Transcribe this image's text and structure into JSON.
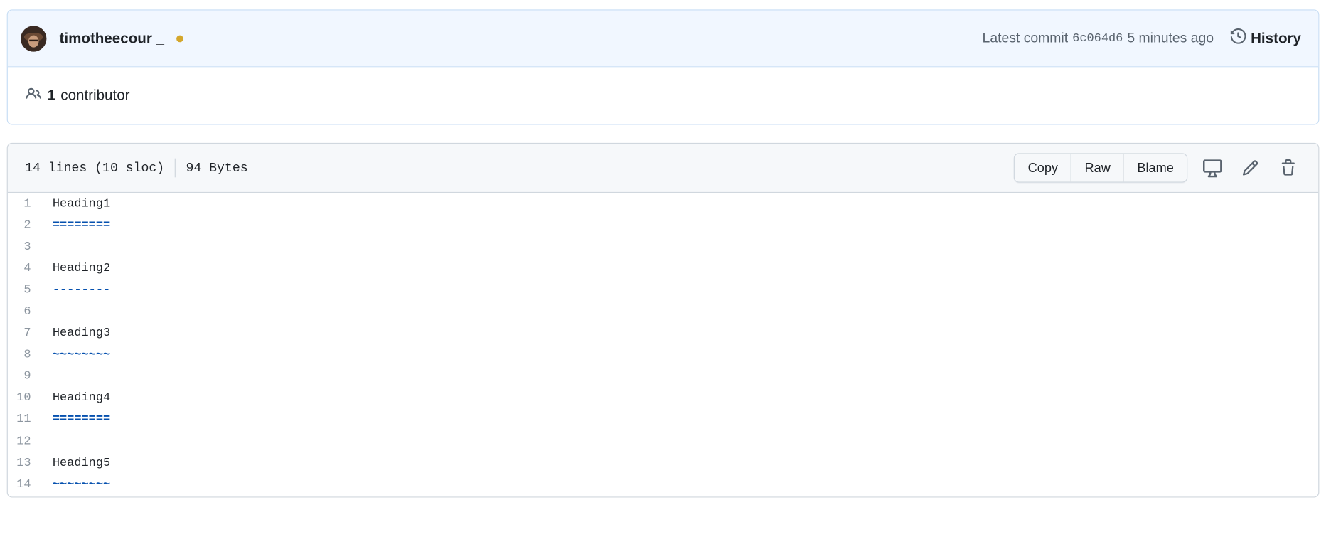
{
  "commit": {
    "author": "timotheecour _",
    "latest_commit_label": "Latest commit",
    "sha": "6c064d6",
    "time": "5 minutes ago",
    "history_label": "History",
    "status_color": "#d4a72c"
  },
  "contributors": {
    "count": "1",
    "label": "contributor"
  },
  "file": {
    "lines_info": "14 lines (10 sloc)",
    "size": "94 Bytes",
    "buttons": {
      "copy": "Copy",
      "raw": "Raw",
      "blame": "Blame"
    },
    "icons": [
      "desktop-icon",
      "pencil-icon",
      "trash-icon"
    ],
    "lines": [
      {
        "n": "1",
        "text": "Heading1",
        "marker": false
      },
      {
        "n": "2",
        "text": "========",
        "marker": true
      },
      {
        "n": "3",
        "text": "",
        "marker": false
      },
      {
        "n": "4",
        "text": "Heading2",
        "marker": false
      },
      {
        "n": "5",
        "text": "--------",
        "marker": true
      },
      {
        "n": "6",
        "text": "",
        "marker": false
      },
      {
        "n": "7",
        "text": "Heading3",
        "marker": false
      },
      {
        "n": "8",
        "text": "~~~~~~~~",
        "marker": true
      },
      {
        "n": "9",
        "text": "",
        "marker": false
      },
      {
        "n": "10",
        "text": "Heading4",
        "marker": false
      },
      {
        "n": "11",
        "text": "========",
        "marker": true
      },
      {
        "n": "12",
        "text": "",
        "marker": false
      },
      {
        "n": "13",
        "text": "Heading5",
        "marker": false
      },
      {
        "n": "14",
        "text": "~~~~~~~~",
        "marker": true
      }
    ]
  },
  "colors": {
    "accent_blue": "#0550ae",
    "header_bg": "#f1f7ff",
    "border": "#d0d7de"
  }
}
